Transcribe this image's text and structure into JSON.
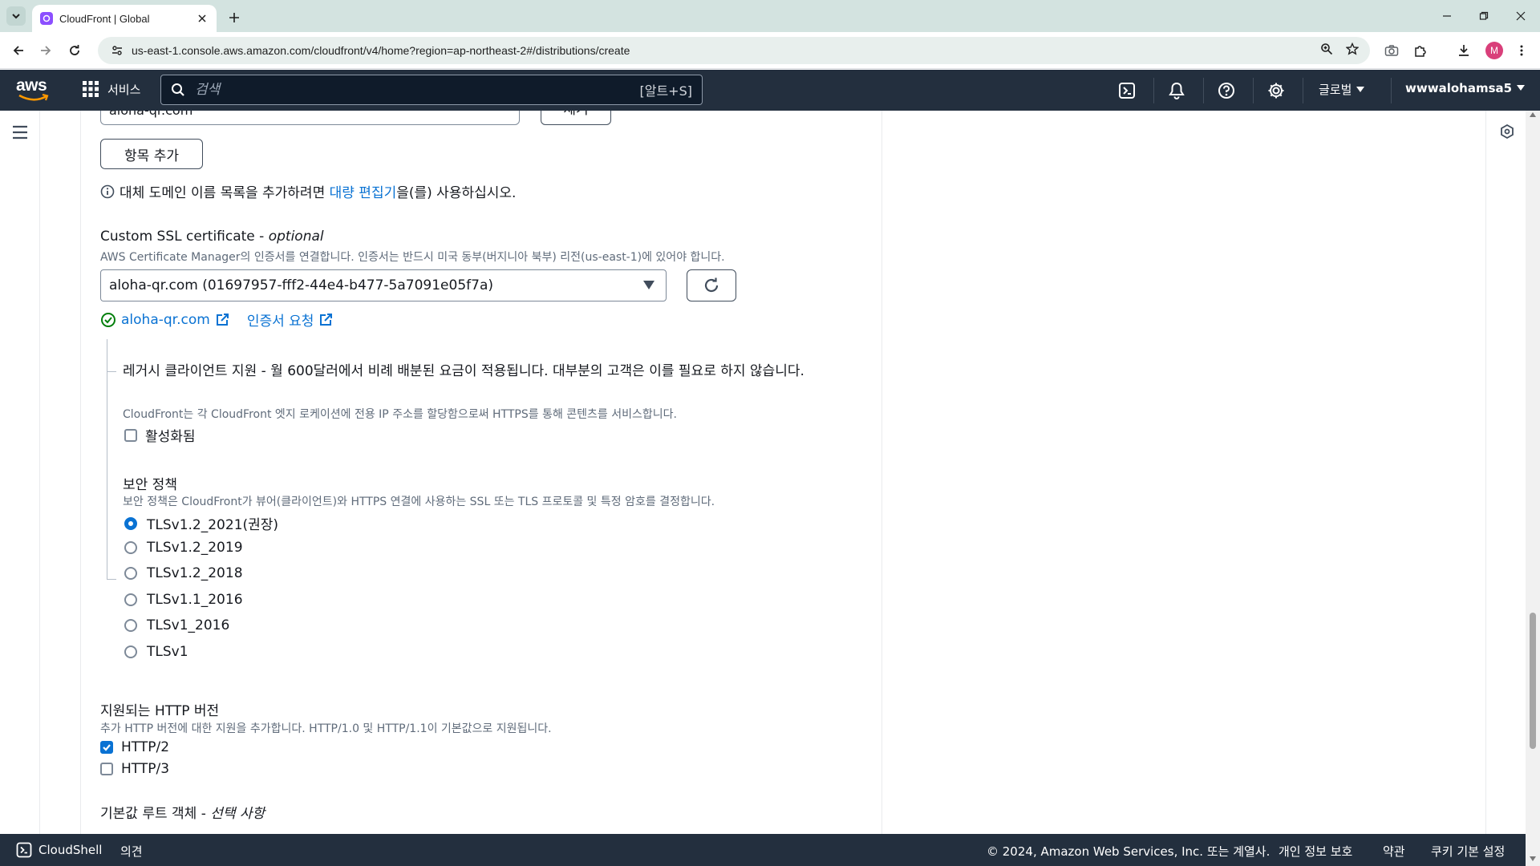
{
  "browser": {
    "tab_title": "CloudFront | Global",
    "url": "us-east-1.console.aws.amazon.com/cloudfront/v4/home?region=ap-northeast-2#/distributions/create",
    "profile_initial": "M"
  },
  "awsnav": {
    "logo": "aws",
    "services_label": "서비스",
    "search_placeholder": "검색",
    "search_shortcut": "[알트+S]",
    "region_label": "글로벌",
    "account_label": "wwwalohamsa5"
  },
  "form": {
    "alt_domain_value": "aloha-qr.com",
    "remove_button": "제거",
    "add_item_button": "항목 추가",
    "bulk_info_prefix": "대체 도메인 이름 목록을 추가하려면 ",
    "bulk_info_link": "대량 편집기",
    "bulk_info_suffix": "을(를) 사용하십시오.",
    "ssl": {
      "label": "Custom SSL certificate - ",
      "label_optional": "optional",
      "description": "AWS Certificate Manager의 인증서를 연결합니다. 인증서는 반드시 미국 동부(버지니아 북부) 리전(us-east-1)에 있어야 합니다.",
      "selected": "aloha-qr.com (01697957-fff2-44e4-b477-5a7091e05f7a)",
      "cert_link": "aloha-qr.com",
      "request_link": "인증서 요청"
    },
    "legacy": {
      "label": "레거시 클라이언트 지원 - 월 600달러에서 비례 배분된 요금이 적용됩니다. 대부분의 고객은 이를 필요로 하지 않습니다.",
      "description": "CloudFront는 각 CloudFront 엣지 로케이션에 전용 IP 주소를 할당함으로써 HTTPS를 통해 콘텐츠를 서비스합니다.",
      "checkbox_label": "활성화됨"
    },
    "security_policy": {
      "label": "보안 정책",
      "description": "보안 정책은 CloudFront가 뷰어(클라이언트)와 HTTPS 연결에 사용하는 SSL 또는 TLS 프로토콜 및 특정 암호를 결정합니다.",
      "options": [
        "TLSv1.2_2021(권장)",
        "TLSv1.2_2019",
        "TLSv1.2_2018",
        "TLSv1.1_2016",
        "TLSv1_2016",
        "TLSv1"
      ],
      "selected_index": 0
    },
    "http_versions": {
      "label": "지원되는 HTTP 버전",
      "description": "추가 HTTP 버전에 대한 지원을 추가합니다. HTTP/1.0 및 HTTP/1.1이 기본값으로 지원됩니다.",
      "options": [
        {
          "label": "HTTP/2",
          "checked": true
        },
        {
          "label": "HTTP/3",
          "checked": false
        }
      ]
    },
    "default_root": {
      "label": "기본값 루트 객체 - ",
      "label_optional": "선택 사항"
    }
  },
  "footer": {
    "cloudshell": "CloudShell",
    "feedback": "의견",
    "copyright": "© 2024, Amazon Web Services, Inc. 또는 계열사.",
    "privacy": "개인 정보 보호",
    "terms": "약관",
    "cookies": "쿠키 기본 설정"
  },
  "colors": {
    "aws_nav_bg": "#232f3e",
    "link": "#0972d3",
    "success": "#037f0c",
    "tab_strip": "#d3e3e0"
  }
}
